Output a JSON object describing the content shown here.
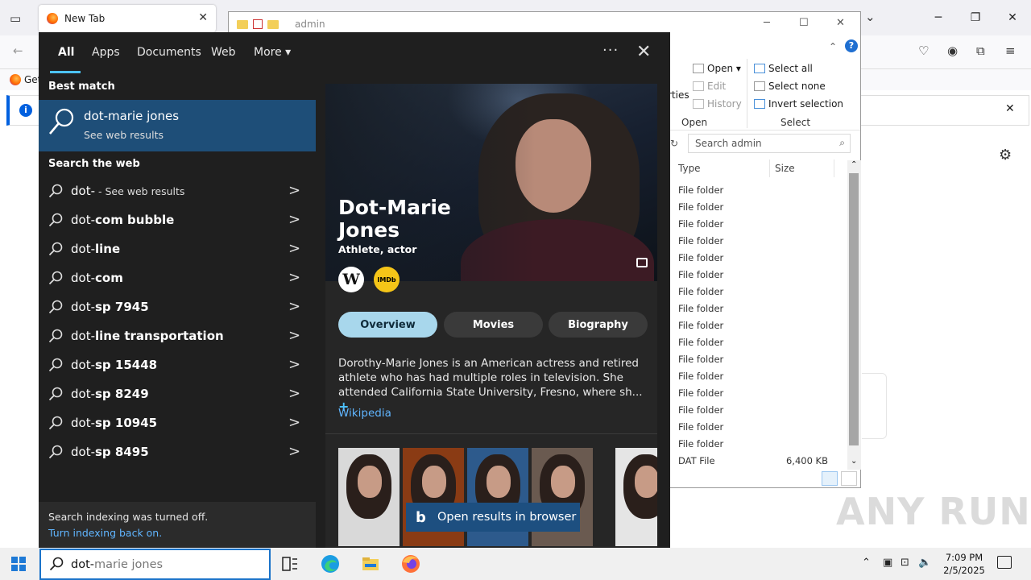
{
  "firefox": {
    "tab_title": "New Tab",
    "bookmark_partial": "Get",
    "notice_icon": "i"
  },
  "explorer": {
    "path": "admin",
    "ribbon": {
      "open": "Open",
      "edit": "Edit",
      "history": "History",
      "properties_partial": "rties",
      "open_group": "Open",
      "select_all": "Select all",
      "select_none": "Select none",
      "invert_selection": "Invert selection",
      "select_group": "Select"
    },
    "search_placeholder": "Search admin",
    "columns": {
      "type": "Type",
      "size": "Size"
    },
    "rows": [
      {
        "type": "File folder",
        "size": ""
      },
      {
        "type": "File folder",
        "size": ""
      },
      {
        "type": "File folder",
        "size": ""
      },
      {
        "type": "File folder",
        "size": ""
      },
      {
        "type": "File folder",
        "size": ""
      },
      {
        "type": "File folder",
        "size": ""
      },
      {
        "type": "File folder",
        "size": ""
      },
      {
        "type": "File folder",
        "size": ""
      },
      {
        "type": "File folder",
        "size": ""
      },
      {
        "type": "File folder",
        "size": ""
      },
      {
        "type": "File folder",
        "size": ""
      },
      {
        "type": "File folder",
        "size": ""
      },
      {
        "type": "File folder",
        "size": ""
      },
      {
        "type": "File folder",
        "size": ""
      },
      {
        "type": "File folder",
        "size": ""
      },
      {
        "type": "File folder",
        "size": ""
      },
      {
        "type": "DAT File",
        "size": "6,400 KB"
      }
    ]
  },
  "search": {
    "tabs": [
      "All",
      "Apps",
      "Documents",
      "Web",
      "More"
    ],
    "more_caret": "▾",
    "dots": "···",
    "close": "✕",
    "best_match_label": "Best match",
    "best_match": {
      "title_typed": "dot-",
      "title_rest": "marie jones",
      "subtitle": "See web results"
    },
    "search_web_label": "Search the web",
    "suggestions": [
      {
        "prefix": "dot-",
        "rest": " - See web results",
        "small": true
      },
      {
        "prefix": "dot-",
        "rest": "com bubble",
        "small": false
      },
      {
        "prefix": "dot-",
        "rest": "line",
        "small": false
      },
      {
        "prefix": "dot-",
        "rest": "com",
        "small": false
      },
      {
        "prefix": "dot-",
        "rest": "sp 7945",
        "small": false
      },
      {
        "prefix": "dot-",
        "rest": "line transportation",
        "small": false
      },
      {
        "prefix": "dot-",
        "rest": "sp 15448",
        "small": false
      },
      {
        "prefix": "dot-",
        "rest": "sp 8249",
        "small": false
      },
      {
        "prefix": "dot-",
        "rest": "sp 10945",
        "small": false
      },
      {
        "prefix": "dot-",
        "rest": "sp 8495",
        "small": false
      }
    ],
    "indexing_off": "Search indexing was turned off.",
    "indexing_link": "Turn indexing back on.",
    "entity": {
      "name_line1": "Dot-Marie",
      "name_line2": "Jones",
      "description": "Athlete, actor",
      "wiki_badge": "W",
      "imdb_badge": "IMDb",
      "pills": [
        "Overview",
        "Movies",
        "Biography"
      ],
      "bio": "Dorothy-Marie Jones is an American actress and retired athlete who has had multiple roles in television. She attended California State University, Fresno, where sh...",
      "expand": "+",
      "source_link": "Wikipedia",
      "open_in_browser": "Open results in browser",
      "bing_glyph": "b"
    }
  },
  "taskbar": {
    "search_typed": "dot-",
    "search_rest": "marie jones",
    "time": "7:09 PM",
    "date": "2/5/2025"
  },
  "watermark": "ANY RUN",
  "colors": {
    "flyout_bg": "#1f1f1f",
    "best_match_bg": "#1e4e78",
    "accent": "#4cc2ff",
    "link": "#60b5ff",
    "active_pill": "#a8d7ec",
    "open_browser_bg": "#1d4f80"
  }
}
